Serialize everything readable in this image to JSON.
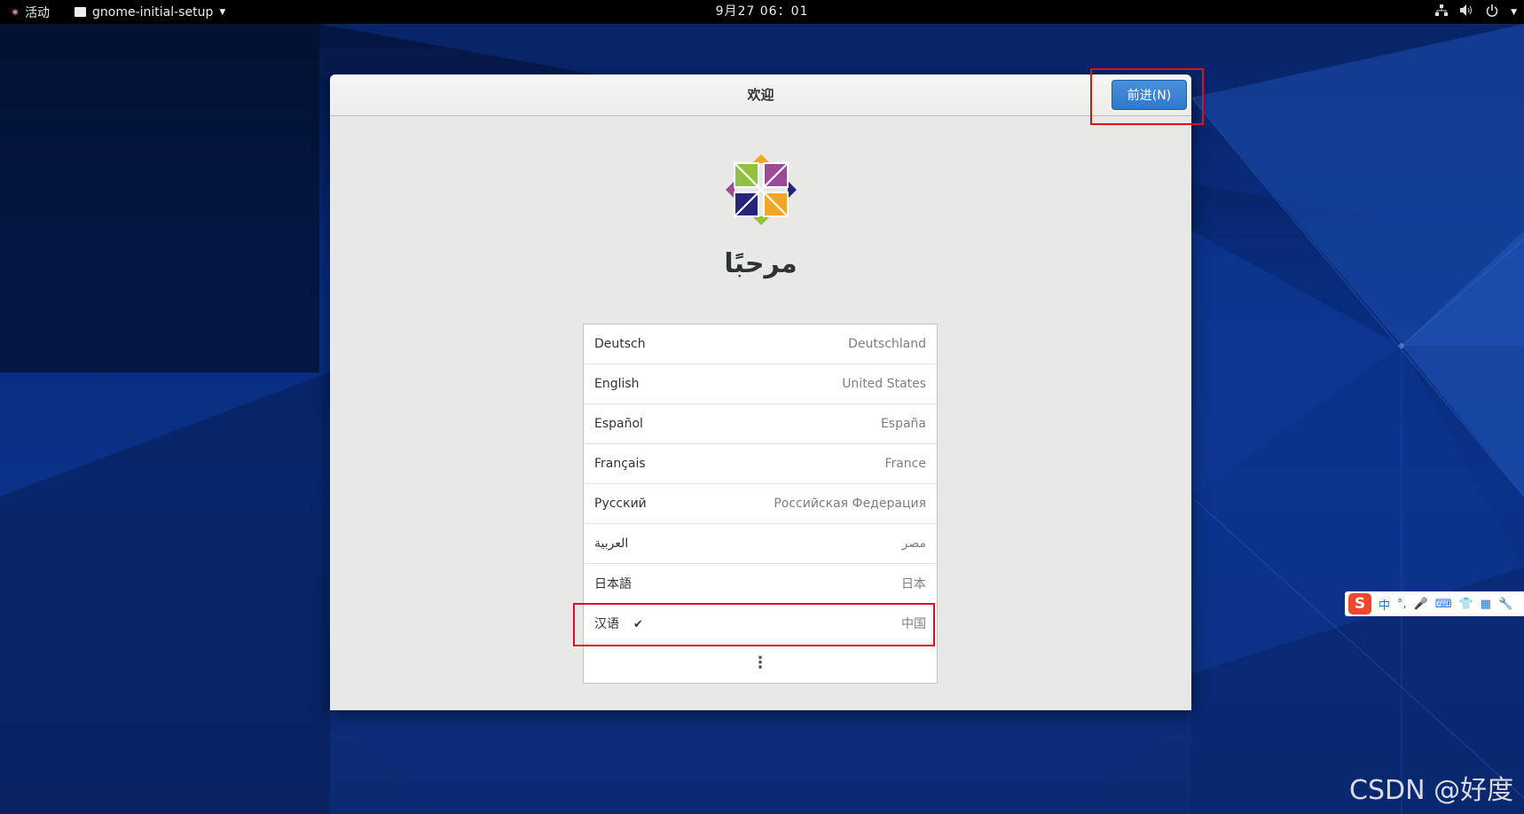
{
  "topbar": {
    "activities_label": "活动",
    "app_menu_label": "gnome-initial-setup",
    "clock": "9月27  06：01",
    "network_icon": "network-wired-icon",
    "volume_icon": "volume-icon",
    "power_icon": "power-icon"
  },
  "window": {
    "title": "欢迎",
    "next_button_label": "前进(N)",
    "welcome_text": "مرحبًا"
  },
  "languages": [
    {
      "name": "Deutsch",
      "region": "Deutschland",
      "selected": false
    },
    {
      "name": "English",
      "region": "United States",
      "selected": false
    },
    {
      "name": "Español",
      "region": "España",
      "selected": false
    },
    {
      "name": "Français",
      "region": "France",
      "selected": false
    },
    {
      "name": "Русский",
      "region": "Российская Федерация",
      "selected": false
    },
    {
      "name": "العربية",
      "region": "مصر",
      "selected": false
    },
    {
      "name": "日本語",
      "region": "日本",
      "selected": false
    },
    {
      "name": "汉语",
      "region": "中国",
      "selected": true
    }
  ],
  "selected_check": "✔",
  "more_label": "⋮",
  "ime": {
    "logo": "S",
    "mode": "中",
    "punct": "°,",
    "items": [
      "🎤",
      "⌨",
      "👕",
      "▦",
      "🔧"
    ]
  },
  "watermark": "CSDN @好度",
  "colors": {
    "accent": "#2e7ad1",
    "highlight": "#e0101a",
    "topbar": "#000000"
  }
}
